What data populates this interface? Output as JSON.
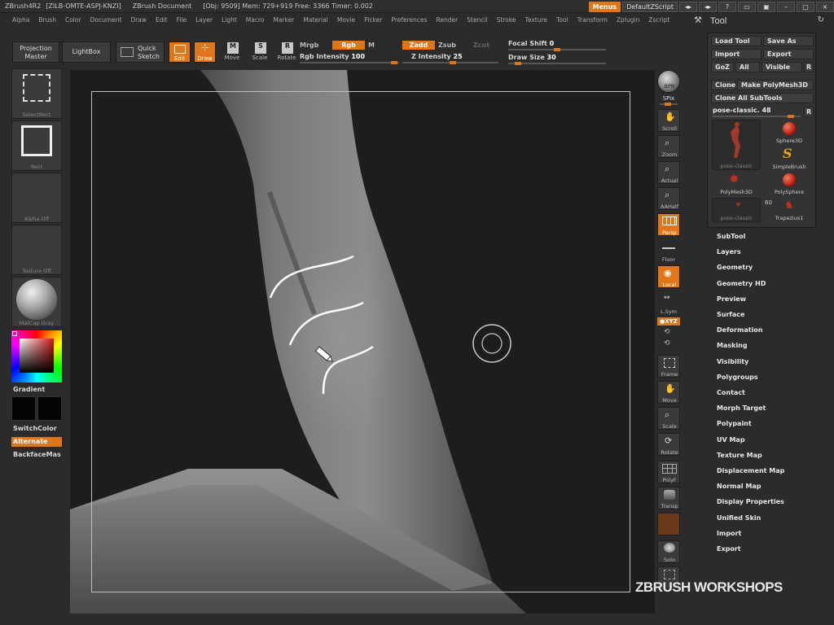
{
  "titlebar": {
    "app": "ZBrush4R2",
    "serial": "[ZILB-OMTE-ASPJ-KNZI]",
    "document": "ZBrush Document",
    "stats": "[Obj: 9509] Mem: 729+919 Free: 3366 Timer: 0.002",
    "menus_btn": "Menus",
    "script_btn": "DefaultZScript"
  },
  "menubar": {
    "items": [
      "Alpha",
      "Brush",
      "Color",
      "Document",
      "Draw",
      "Edit",
      "File",
      "Layer",
      "Light",
      "Macro",
      "Marker",
      "Material",
      "Movie",
      "Picker",
      "Preferences",
      "Render",
      "Stencil",
      "Stroke",
      "Texture",
      "Tool",
      "Transform",
      "Zplugin",
      "Zscript"
    ]
  },
  "shelf": {
    "projection_master": "Projection Master",
    "lightbox": "LightBox",
    "quick_sketch": "Quick Sketch",
    "edit": "Edit",
    "draw": "Draw",
    "move": "Move",
    "scale": "Scale",
    "rotate": "Rotate",
    "mrgb": "Mrgb",
    "rgb": "Rgb",
    "m": "M",
    "rgb_intensity_label": "Rgb Intensity",
    "rgb_intensity": "100",
    "zadd": "Zadd",
    "zsub": "Zsub",
    "zcut": "Zcut",
    "z_intensity_label": "Z Intensity",
    "z_intensity": "25",
    "focal_shift_label": "Focal Shift",
    "focal_shift": "0",
    "draw_size_label": "Draw Size",
    "draw_size": "30"
  },
  "lefttray": {
    "select_rect": "SelectRect",
    "rect": "Rect",
    "alpha_off": "Alpha Off",
    "texture_off": "Texture Off",
    "matcap": "MatCap Gray",
    "gradient": "Gradient",
    "switchcolor": "SwitchColor",
    "alternate": "Alternate",
    "backfacemask": "BackfaceMas"
  },
  "rshelf": {
    "bpr": "BPR",
    "spix": "SPix",
    "scroll": "Scroll",
    "zoom": "Zoom",
    "actual": "Actual",
    "aahalf": "AAHalf",
    "persp": "Persp",
    "floor": "Floor",
    "local": "Local",
    "lsym": "L.Sym",
    "xyz": "●XYZ",
    "frame": "Frame",
    "move": "Move",
    "scale": "Scale",
    "rotate": "Rotate",
    "polyf": "PolyF",
    "transp": "Transp",
    "solo": "Solo"
  },
  "toolpanel": {
    "title": "Tool",
    "load_tool": "Load Tool",
    "save_as": "Save As",
    "import": "Import",
    "export": "Export",
    "goz": "GoZ",
    "all": "All",
    "visible": "Visible",
    "r": "R",
    "clone": "Clone",
    "make_polymesh": "Make PolyMesh3D",
    "clone_all": "Clone All SubTools",
    "current_tool": "pose-classic. 48",
    "thumbs": [
      {
        "label": "pose-classic"
      },
      {
        "label": "Sphere3D"
      },
      {
        "label": "SimpleBrush"
      },
      {
        "label": "PolyMesh3D"
      },
      {
        "label": "PolySphere"
      },
      {
        "label": "pose-classic"
      },
      {
        "label": "Trapezius1"
      }
    ],
    "count": "60"
  },
  "subpalettes": [
    "SubTool",
    "Layers",
    "Geometry",
    "Geometry HD",
    "Preview",
    "Surface",
    "Deformation",
    "Masking",
    "Visibility",
    "Polygroups",
    "Contact",
    "Morph Target",
    "Polypaint",
    "UV Map",
    "Texture Map",
    "Displacement Map",
    "Normal Map",
    "Display Properties",
    "Unified Skin",
    "Import",
    "Export"
  ],
  "watermark": "ZBRUSH WORKSHOPS"
}
